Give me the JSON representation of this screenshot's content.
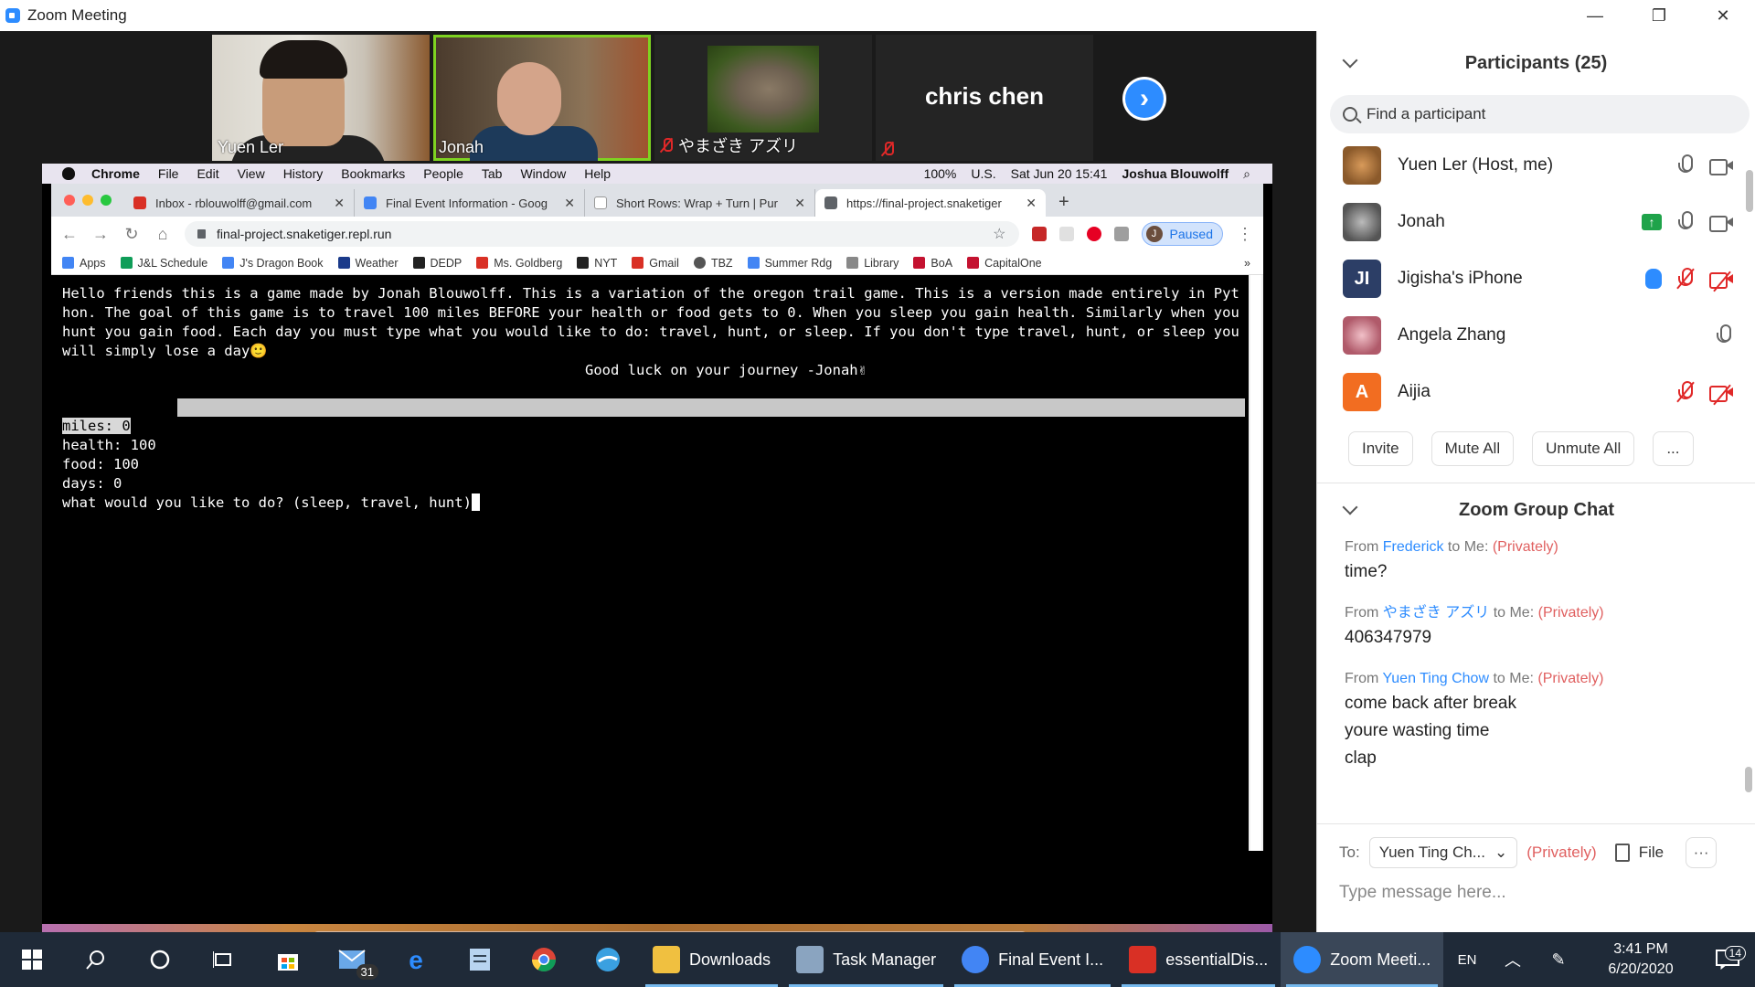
{
  "window": {
    "title": "Zoom Meeting",
    "min": "—",
    "restore": "❐",
    "close": "✕"
  },
  "gallery": {
    "tiles": [
      {
        "name": "Yuen Ler"
      },
      {
        "name": "Jonah"
      },
      {
        "name": "やまざき アズリ"
      },
      {
        "name": "chris chen"
      }
    ],
    "next_glyph": "›"
  },
  "mac": {
    "menu": [
      "Chrome",
      "File",
      "Edit",
      "View",
      "History",
      "Bookmarks",
      "People",
      "Tab",
      "Window",
      "Help"
    ],
    "status": {
      "battery": "100%",
      "locale": "U.S.",
      "datetime": "Sat Jun 20  15:41",
      "user": "Joshua Blouwolff"
    }
  },
  "browser": {
    "tabs": [
      {
        "label": "Inbox - rblouwolff@gmail.com",
        "color": "#d93025"
      },
      {
        "label": "Final Event Information - Goog",
        "color": "#4285f4"
      },
      {
        "label": "Short Rows: Wrap + Turn | Pur",
        "color": "#ffffff"
      },
      {
        "label": "https://final-project.snaketiger",
        "color": "#5f6368"
      }
    ],
    "new_tab": "+",
    "url": "final-project.snaketiger.repl.run",
    "paused_label": "Paused",
    "profile_initial": "J",
    "bookmarks": [
      {
        "label": "Apps",
        "color": "#4285f4"
      },
      {
        "label": "J&L Schedule",
        "color": "#0f9d58"
      },
      {
        "label": "J's Dragon Book",
        "color": "#4285f4"
      },
      {
        "label": "Weather",
        "color": "#1a3a8a"
      },
      {
        "label": "DEDP",
        "color": "#222222"
      },
      {
        "label": "Ms. Goldberg",
        "color": "#d93025"
      },
      {
        "label": "NYT",
        "color": "#222222"
      },
      {
        "label": "Gmail",
        "color": "#d93025"
      },
      {
        "label": "TBZ",
        "color": "#555555"
      },
      {
        "label": "Summer Rdg",
        "color": "#4285f4"
      },
      {
        "label": "Library",
        "color": "#555555"
      },
      {
        "label": "BoA",
        "color": "#c41230"
      },
      {
        "label": "CapitalOne",
        "color": "#c41230"
      }
    ],
    "bookmarks_more": "»"
  },
  "console": {
    "intro": "Hello friends this is a game made by Jonah Blouwolff. This is a variation of the oregon trail game. This is a version made entirely in Python. The goal of this game is to travel 100 miles BEFORE your health or food gets to 0. When you sleep you gain health. Similarly when you hunt you gain food. Each day you must type what you would like to do: travel, hunt, or sleep. If you don't type travel, hunt, or sleep you will simply lose a day🙂",
    "good_luck": "Good luck on your journey   -Jonah✌",
    "stats": {
      "miles": "miles: 0",
      "health": "health: 100",
      "food": "food: 100",
      "days": "days: 0"
    },
    "prompt": "what would you like to do? (sleep, travel, hunt)"
  },
  "taskbar": {
    "mail_badge": "31",
    "apps": [
      {
        "label": "Downloads",
        "color": "#f0c040"
      },
      {
        "label": "Task Manager",
        "color": "#8aa4c0"
      },
      {
        "label": "Final Event I...",
        "color": "#4285f4"
      },
      {
        "label": "essentialDis...",
        "color": "#d93025"
      },
      {
        "label": "Zoom Meeti...",
        "color": "#2d8cff"
      }
    ],
    "language": "EN",
    "time": "3:41 PM",
    "date": "6/20/2020",
    "notif_count": "14"
  },
  "participants": {
    "title": "Participants (25)",
    "search_placeholder": "Find a participant",
    "list": [
      {
        "name": "Yuen Ler (Host, me)",
        "avatar": "",
        "color": "#8b5a2b"
      },
      {
        "name": "Jonah",
        "avatar": "",
        "color": "#888888"
      },
      {
        "name": "Jigisha's iPhone",
        "avatar": "JI",
        "color": "#2c3e66"
      },
      {
        "name": "Angela Zhang",
        "avatar": "",
        "color": "#b05a6a"
      },
      {
        "name": "Aijia",
        "avatar": "A",
        "color": "#f26d21"
      }
    ],
    "buttons": {
      "invite": "Invite",
      "mute_all": "Mute All",
      "unmute_all": "Unmute All",
      "more": "..."
    }
  },
  "chat": {
    "title": "Zoom Group Chat",
    "messages": [
      {
        "from_prefix": "From",
        "sender": "Frederick",
        "to": "to Me:",
        "priv": "(Privately)",
        "lines": [
          "time?"
        ]
      },
      {
        "from_prefix": "From",
        "sender": "やまざき アズリ",
        "to": "to Me:",
        "priv": "(Privately)",
        "lines": [
          "406347979"
        ]
      },
      {
        "from_prefix": "From",
        "sender": "Yuen Ting Chow",
        "to": "to Me:",
        "priv": "(Privately)",
        "lines": [
          "come back after break",
          "youre wasting time",
          "clap"
        ]
      }
    ],
    "to_label": "To:",
    "to_value": "Yuen Ting Ch...",
    "priv_label": "(Privately)",
    "file_label": "File",
    "more": "···",
    "placeholder": "Type message here..."
  }
}
